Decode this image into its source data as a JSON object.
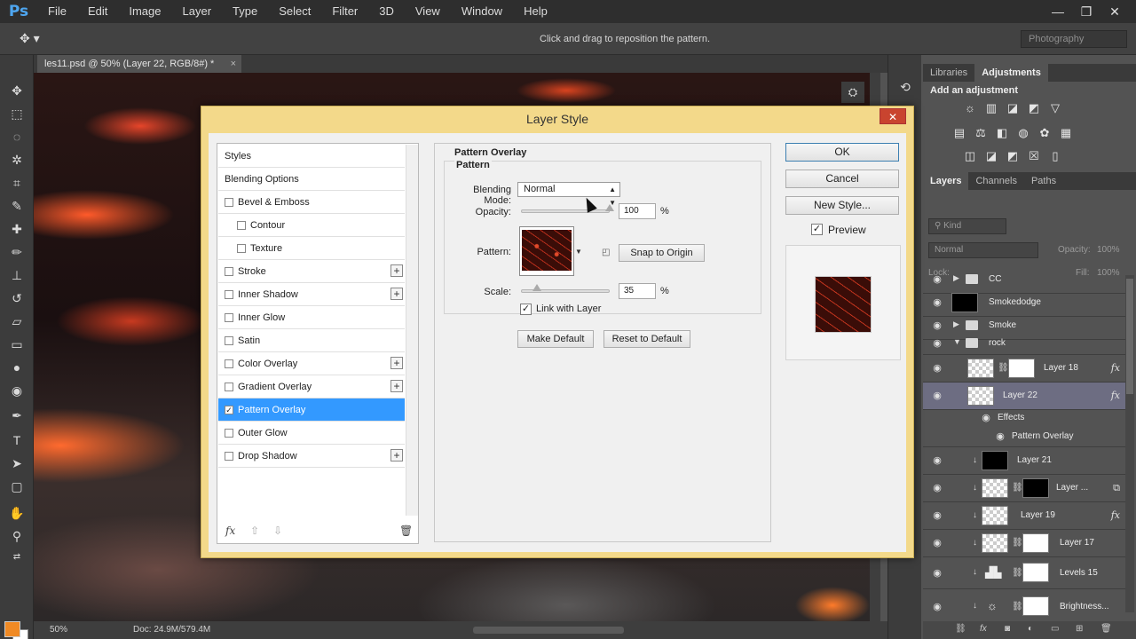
{
  "app": {
    "logo": "Ps",
    "menu": [
      "File",
      "Edit",
      "Image",
      "Layer",
      "Type",
      "Select",
      "Filter",
      "3D",
      "View",
      "Window",
      "Help"
    ],
    "window_controls": {
      "minimize": "—",
      "restore": "❐",
      "close": "✕"
    }
  },
  "options_bar": {
    "hint": "Click and drag to reposition the pattern.",
    "workspace": "Photography"
  },
  "document": {
    "tab_title": "les11.psd @ 50% (Layer 22, RGB/8#) *",
    "tab_close": "×",
    "zoom": "50%",
    "doc_size": "Doc: 24.9M/579.4M"
  },
  "colors": {
    "foreground": "#f08a24",
    "background": "#ffffff",
    "selection": "#3399ff",
    "dialog_frame": "#f3d98a"
  },
  "dialog": {
    "title": "Layer Style",
    "close": "✕",
    "styles": [
      {
        "label": "Styles",
        "checkbox": false,
        "checked": false,
        "plus": false,
        "indent": 0,
        "selected": false
      },
      {
        "label": "Blending Options",
        "checkbox": false,
        "checked": false,
        "plus": false,
        "indent": 0,
        "selected": false
      },
      {
        "label": "Bevel & Emboss",
        "checkbox": true,
        "checked": false,
        "plus": false,
        "indent": 0,
        "selected": false
      },
      {
        "label": "Contour",
        "checkbox": true,
        "checked": false,
        "plus": false,
        "indent": 1,
        "selected": false
      },
      {
        "label": "Texture",
        "checkbox": true,
        "checked": false,
        "plus": false,
        "indent": 1,
        "selected": false
      },
      {
        "label": "Stroke",
        "checkbox": true,
        "checked": false,
        "plus": true,
        "indent": 0,
        "selected": false
      },
      {
        "label": "Inner Shadow",
        "checkbox": true,
        "checked": false,
        "plus": true,
        "indent": 0,
        "selected": false
      },
      {
        "label": "Inner Glow",
        "checkbox": true,
        "checked": false,
        "plus": false,
        "indent": 0,
        "selected": false
      },
      {
        "label": "Satin",
        "checkbox": true,
        "checked": false,
        "plus": false,
        "indent": 0,
        "selected": false
      },
      {
        "label": "Color Overlay",
        "checkbox": true,
        "checked": false,
        "plus": true,
        "indent": 0,
        "selected": false
      },
      {
        "label": "Gradient Overlay",
        "checkbox": true,
        "checked": false,
        "plus": true,
        "indent": 0,
        "selected": false
      },
      {
        "label": "Pattern Overlay",
        "checkbox": true,
        "checked": true,
        "plus": false,
        "indent": 0,
        "selected": true
      },
      {
        "label": "Outer Glow",
        "checkbox": true,
        "checked": false,
        "plus": false,
        "indent": 0,
        "selected": false
      },
      {
        "label": "Drop Shadow",
        "checkbox": true,
        "checked": false,
        "plus": true,
        "indent": 0,
        "selected": false
      }
    ],
    "footer_fx": "fx",
    "section_title": "Pattern Overlay",
    "group_title": "Pattern",
    "blend_mode_label": "Blending Mode:",
    "blend_mode_value": "Normal",
    "opacity_label": "Opacity:",
    "opacity_value": "100",
    "opacity_fraction": 1.0,
    "percent": "%",
    "pattern_label": "Pattern:",
    "snap_button": "Snap to Origin",
    "scale_label": "Scale:",
    "scale_value": "35",
    "scale_fraction": 0.18,
    "link_label": "Link with Layer",
    "link_checked": true,
    "make_default": "Make Default",
    "reset_default": "Reset to Default",
    "ok": "OK",
    "cancel": "Cancel",
    "new_style": "New Style...",
    "preview_label": "Preview",
    "preview_checked": true
  },
  "panels": {
    "top_tabs": [
      "Libraries",
      "Adjustments"
    ],
    "adjustments_title": "Add an adjustment",
    "layer_tabs": [
      "Layers",
      "Channels",
      "Paths"
    ],
    "kind_filter": "Kind",
    "blend_mode": "Normal",
    "opacity_label": "Opacity:",
    "opacity_value": "100%",
    "lock_label": "Lock:",
    "fill_label": "Fill:",
    "fill_value": "100%"
  },
  "layers": [
    {
      "name": "CC",
      "type": "folder",
      "collapsed": true
    },
    {
      "name": "Smokedodge",
      "type": "layer"
    },
    {
      "name": "Smoke",
      "type": "folder",
      "collapsed": true
    },
    {
      "name": "rock",
      "type": "folder",
      "collapsed": false
    },
    {
      "name": "Layer 18",
      "fx": true
    },
    {
      "name": "Layer 22",
      "fx": true,
      "selected": true
    },
    {
      "name": "Effects",
      "type": "effects"
    },
    {
      "name": "Pattern Overlay",
      "type": "effect-item"
    },
    {
      "name": "Layer 21"
    },
    {
      "name": "Layer ..."
    },
    {
      "name": "Layer 19",
      "fx": true
    },
    {
      "name": "Layer 17"
    },
    {
      "name": "Levels 15"
    },
    {
      "name": "Brightness..."
    }
  ]
}
